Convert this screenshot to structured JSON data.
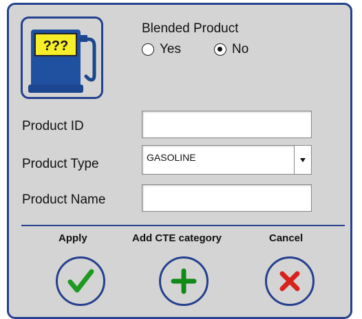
{
  "blended": {
    "label": "Blended Product",
    "options": [
      {
        "label": "Yes",
        "selected": false
      },
      {
        "label": "No",
        "selected": true
      }
    ]
  },
  "fields": {
    "product_id": {
      "label": "Product ID",
      "value": ""
    },
    "product_type": {
      "label": "Product Type",
      "value": "GASOLINE"
    },
    "product_name": {
      "label": "Product Name",
      "value": ""
    }
  },
  "pump_icon": {
    "text": "???"
  },
  "actions": {
    "apply": {
      "label": "Apply",
      "icon": "checkmark-icon"
    },
    "add_cte": {
      "label": "Add CTE category",
      "icon": "plus-icon"
    },
    "cancel": {
      "label": "Cancel",
      "icon": "x-icon"
    }
  },
  "colors": {
    "border": "#24408e",
    "background": "#d4d4d4",
    "apply_green": "#1e9a22",
    "add_green": "#128a18",
    "cancel_red": "#d6241c",
    "pump_blue": "#2050a0",
    "sign_yellow": "#f7ee2a"
  }
}
